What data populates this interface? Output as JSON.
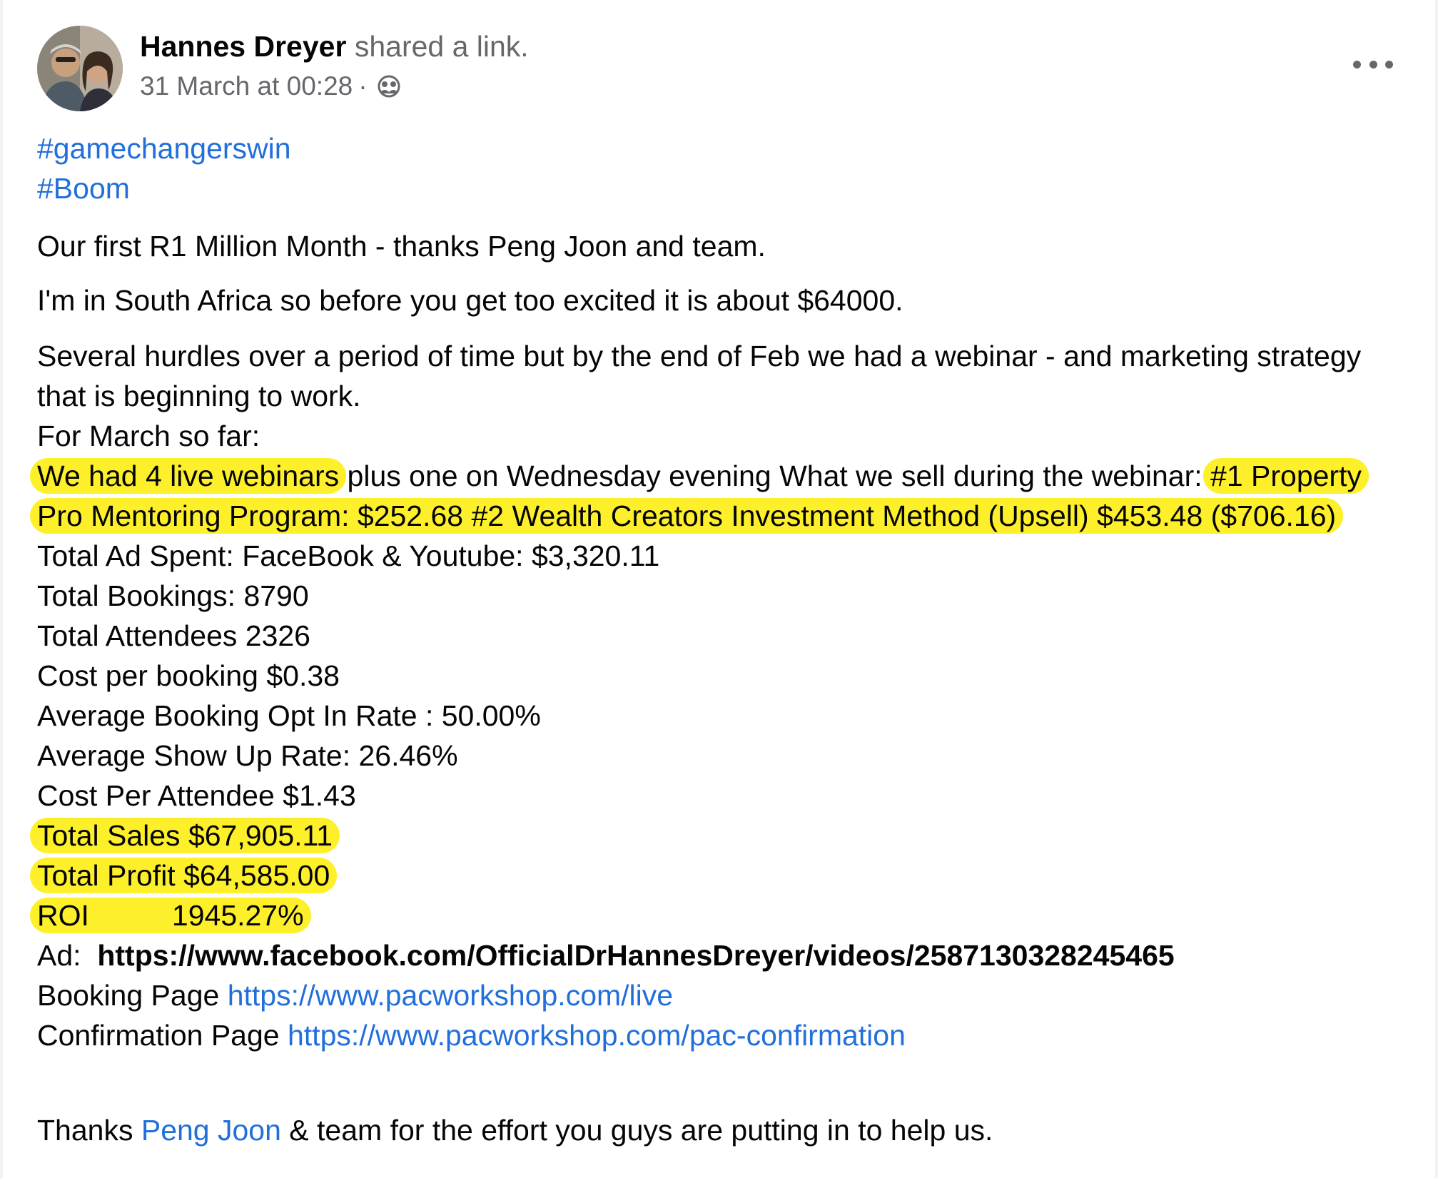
{
  "post": {
    "author": "Hannes Dreyer",
    "action": "shared a link.",
    "timestamp": "31 March at 00:28",
    "separator": "·",
    "audience_icon": "friends-icon",
    "more_icon": "more-options-icon"
  },
  "hashtags": [
    "#gamechangerswin",
    "#Boom"
  ],
  "paragraphs": {
    "p1": "Our first R1 Million Month - thanks Peng Joon and team.",
    "p2": "I'm in South Africa so before you get too excited it is about $64000.",
    "p3": "Several hurdles over a period of time but by the end of Feb we had a webinar - and marketing strategy that is beginning to work.",
    "p3b": "For March so far:"
  },
  "webinars": {
    "highlight": "We had 4 live webinars",
    "middle": " plus one on Wednesday evening What we sell during the webinar: ",
    "products": "#1 Property Pro Mentoring Program: $252.68 #2 Wealth Creators Investment Method (Upsell) $453.48 ($706.16)"
  },
  "stats": [
    "Total Ad Spent: FaceBook & Youtube: $3,320.11",
    "Total Bookings: 8790",
    "Total Attendees 2326",
    "Cost per booking $0.38",
    "Average Booking Opt In Rate : 50.00%",
    "Average Show Up Rate: 26.46%",
    "Cost Per Attendee $1.43"
  ],
  "highlighted_stats": {
    "sales": "Total Sales $67,905.11",
    "profit": "Total Profit $64,585.00",
    "roi_label": "ROI",
    "roi_value": "1945.27%"
  },
  "links": {
    "ad_label": "Ad:",
    "ad_url": "https://www.facebook.com/OfficialDrHannesDreyer/videos/2587130328245465",
    "booking_label": "Booking Page",
    "booking_url": "https://www.pacworkshop.com/live",
    "confirm_label": "Confirmation Page",
    "confirm_url": "https://www.pacworkshop.com/pac-confirmation"
  },
  "thanks": {
    "before": "Thanks ",
    "mention": "Peng Joon",
    "after": " & team for the effort you guys are putting in to help us."
  },
  "colors": {
    "link": "#216fdb",
    "highlight": "#fdf02b",
    "secondary_text": "#65676b",
    "text": "#050505"
  }
}
